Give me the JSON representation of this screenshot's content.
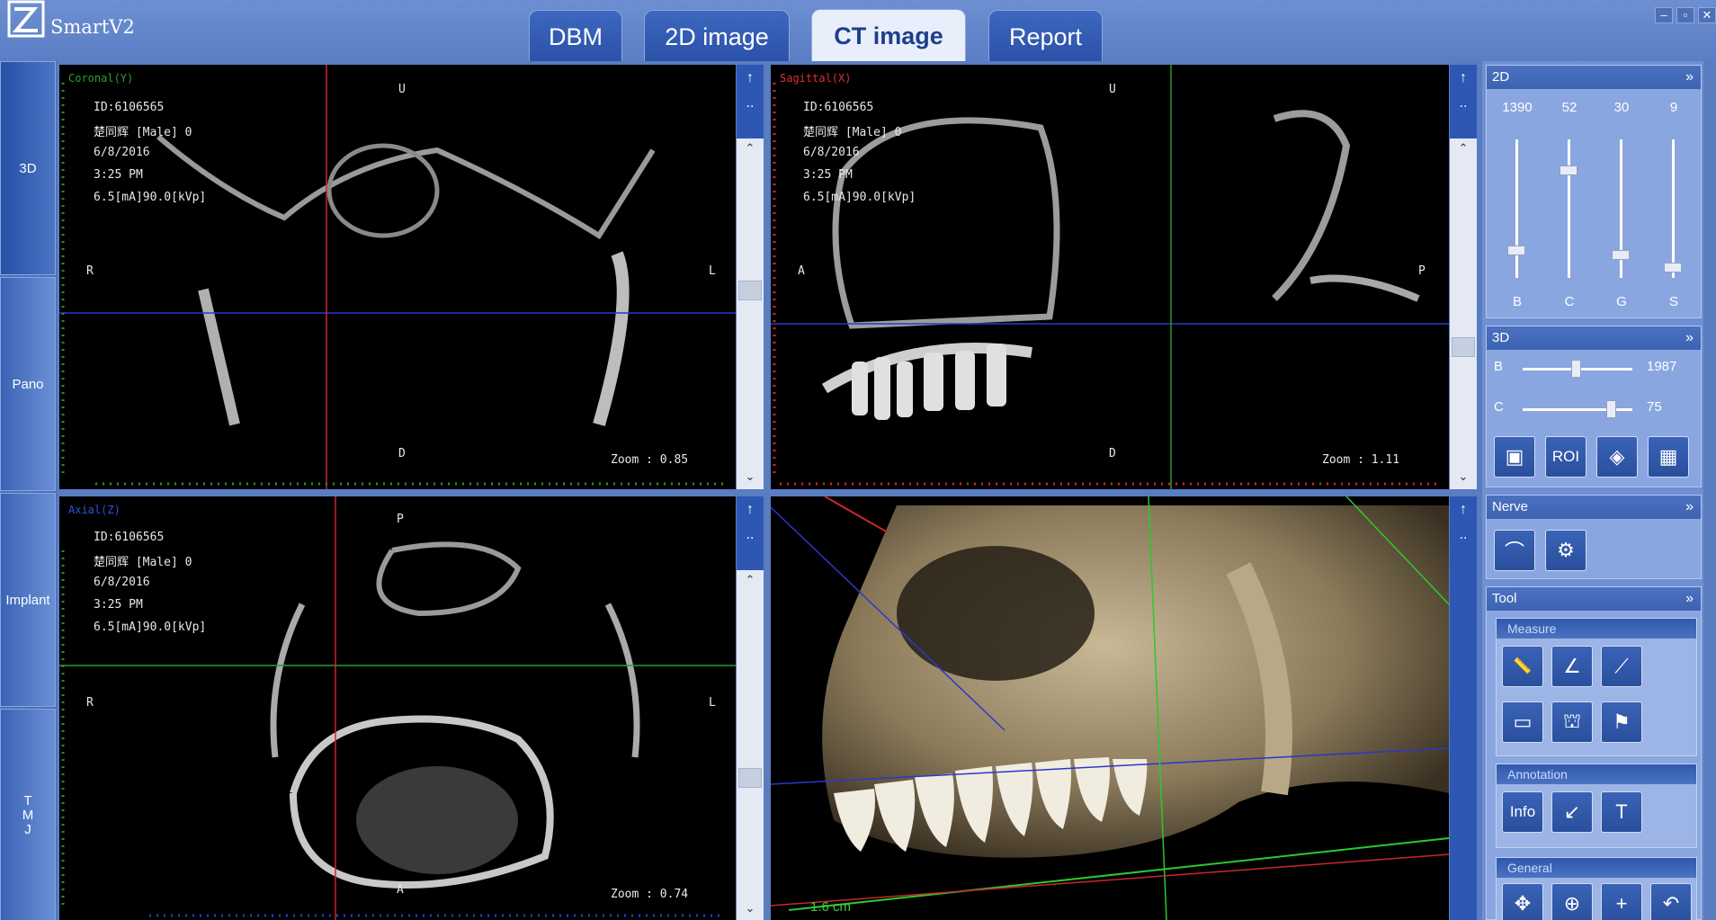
{
  "app": {
    "title": "SmartV2"
  },
  "tabs": [
    {
      "label": "DBM",
      "active": false
    },
    {
      "label": "2D image",
      "active": false
    },
    {
      "label": "CT image",
      "active": true
    },
    {
      "label": "Report",
      "active": false
    }
  ],
  "window_controls": [
    "–",
    "▫",
    "✕"
  ],
  "left_nav": [
    {
      "label": "3D"
    },
    {
      "label": "Pano"
    },
    {
      "label": "Implant"
    },
    {
      "label": "T\nM\nJ"
    }
  ],
  "views": {
    "coronal": {
      "title": "Coronal(Y)",
      "title_color": "#2e9e2e",
      "id": "ID:6106565",
      "patient": "楚同辉 [Male] 0",
      "date": "6/8/2016",
      "time": "3:25 PM",
      "exposure": "6.5[mA]90.0[kVp]",
      "top": "U",
      "bottom": "D",
      "left": "R",
      "right": "L",
      "zoom": "Zoom : 0.85"
    },
    "sagittal": {
      "title": "Sagittal(X)",
      "title_color": "#e03030",
      "id": "ID:6106565",
      "patient": "楚同辉 [Male] 0",
      "date": "6/8/2016",
      "time": "3:25 PM",
      "exposure": "6.5[mA]90.0[kVp]",
      "top": "U",
      "bottom": "D",
      "left": "A",
      "right": "P",
      "zoom": "Zoom : 1.11"
    },
    "axial": {
      "title": "Axial(Z)",
      "title_color": "#3050e0",
      "id": "ID:6106565",
      "patient": "楚同辉 [Male] 0",
      "date": "6/8/2016",
      "time": "3:25 PM",
      "exposure": "6.5[mA]90.0[kVp]",
      "top": "P",
      "bottom": "A",
      "left": "R",
      "right": "L",
      "zoom": "Zoom : 0.74"
    },
    "render3d": {
      "scale": "1.6 cm"
    }
  },
  "scroll_buttons": {
    "up": "↑",
    "more": "..",
    "arrow_up": "⌃",
    "arrow_down": "⌄"
  },
  "panel_2d": {
    "title": "2D",
    "chevron": "»",
    "sliders": [
      {
        "value": "1390",
        "label": "B",
        "level": 0.2
      },
      {
        "value": "52",
        "label": "C",
        "level": 0.78
      },
      {
        "value": "30",
        "label": "G",
        "level": 0.17
      },
      {
        "value": "9",
        "label": "S",
        "level": 0.08
      }
    ]
  },
  "panel_3d": {
    "title": "3D",
    "chevron": "»",
    "sliders": [
      {
        "label": "B",
        "value": "1987",
        "level": 0.48
      },
      {
        "label": "C",
        "value": "75",
        "level": 0.8
      }
    ],
    "buttons": [
      {
        "name": "volume-cube-icon",
        "glyph": "▣"
      },
      {
        "name": "roi-cube-icon",
        "glyph": "ROI"
      },
      {
        "name": "cut-cube-icon",
        "glyph": "◈"
      },
      {
        "name": "grid-plane-icon",
        "glyph": "▦"
      }
    ]
  },
  "panel_nerve": {
    "title": "Nerve",
    "chevron": "»",
    "buttons": [
      {
        "name": "nerve-draw-icon",
        "glyph": "⌒"
      },
      {
        "name": "nerve-edit-icon",
        "glyph": "⚙"
      }
    ]
  },
  "panel_tool": {
    "title": "Tool",
    "chevron": "»",
    "measure": {
      "title": "Measure",
      "buttons": [
        {
          "name": "ruler-icon",
          "glyph": "📏"
        },
        {
          "name": "angle-icon",
          "glyph": "∠"
        },
        {
          "name": "profile-icon",
          "glyph": "⟋"
        },
        {
          "name": "rectangle-icon",
          "glyph": "▭"
        },
        {
          "name": "tooth-icon",
          "glyph": "⛫"
        },
        {
          "name": "density-icon",
          "glyph": "⚑"
        }
      ]
    },
    "annotation": {
      "title": "Annotation",
      "buttons": [
        {
          "name": "info-icon",
          "glyph": "Info"
        },
        {
          "name": "arrow-icon",
          "glyph": "↙"
        },
        {
          "name": "text-icon",
          "glyph": "T"
        }
      ]
    },
    "general": {
      "title": "General",
      "buttons": [
        {
          "name": "pan-icon",
          "glyph": "✥"
        },
        {
          "name": "zoom-icon",
          "glyph": "⊕"
        },
        {
          "name": "crosshair-icon",
          "glyph": "+"
        },
        {
          "name": "undo-icon",
          "glyph": "↶"
        }
      ]
    }
  }
}
